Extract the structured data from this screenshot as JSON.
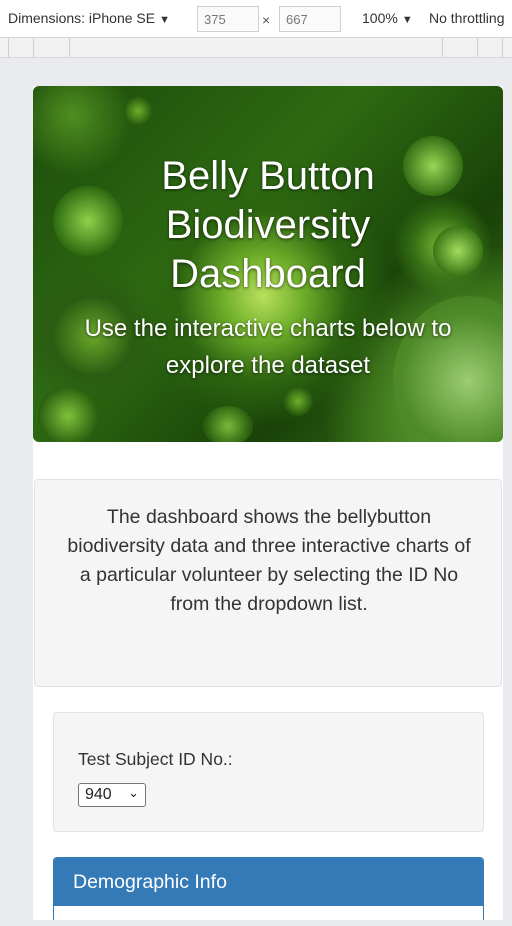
{
  "devtools": {
    "device_label": "Dimensions: iPhone SE",
    "width_value": "375",
    "height_value": "667",
    "times": "×",
    "zoom_label": "100%",
    "throttle_label": "No throttling"
  },
  "hero": {
    "title_line1": "Belly Button",
    "title_line2": "Biodiversity",
    "title_line3": "Dashboard",
    "subtitle_line1": "Use the interactive charts below to",
    "subtitle_line2": "explore the dataset"
  },
  "description": {
    "line1": "The dashboard shows the bellybutton",
    "line2": "biodiversity data and three interactive charts of",
    "line3": "a particular volunteer by selecting the ID No",
    "line4": "from the dropdown list."
  },
  "selector": {
    "label": "Test Subject ID No.:",
    "selected_value": "940"
  },
  "demographic": {
    "heading": "Demographic Info"
  },
  "colors": {
    "panel_primary": "#337ab7",
    "well_bg": "#f5f5f5",
    "hero_green": "#2d6a12"
  }
}
